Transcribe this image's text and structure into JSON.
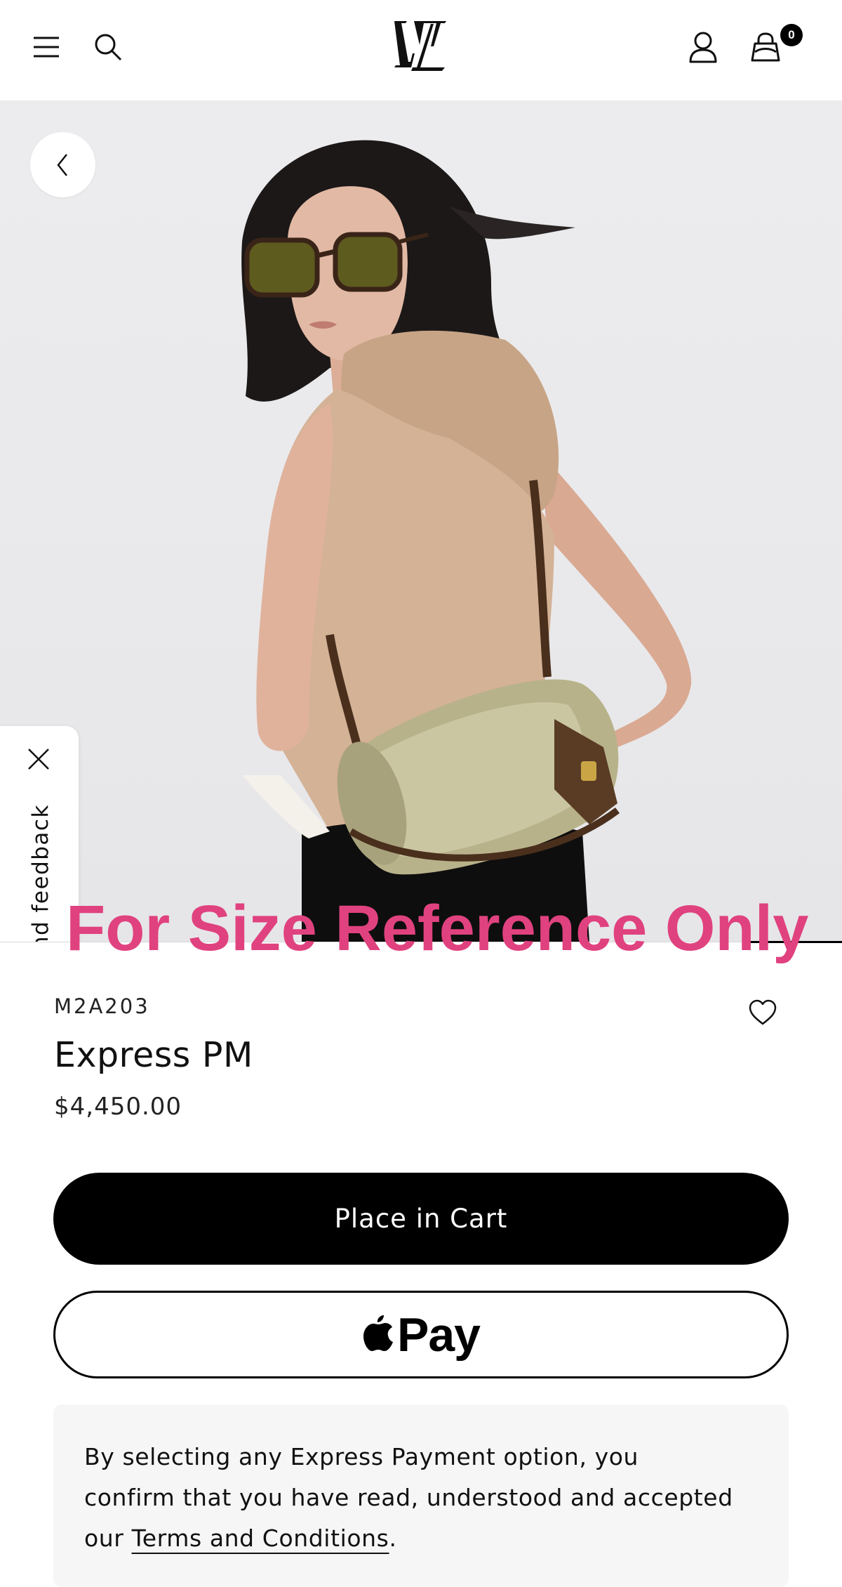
{
  "header": {
    "menu_icon": "menu-icon",
    "search_icon": "search-icon",
    "logo_icon": "lv-logo",
    "account_icon": "account-icon",
    "bag_icon": "shopping-bag-icon",
    "bag_count": "0"
  },
  "hero": {
    "back_icon": "chevron-left-icon",
    "feedback_label": "Send feedback",
    "feedback_close_icon": "close-icon",
    "watermark": "For Size Reference Only",
    "watermark_color": "#e0427f",
    "image_progress": 0.11
  },
  "product": {
    "sku": "M2A203",
    "name": "Express PM",
    "price": "$4,450.00",
    "wishlist_icon": "heart-icon"
  },
  "actions": {
    "cart_label": "Place in Cart",
    "apple_pay_label": "Pay",
    "apple_icon": "apple-icon"
  },
  "notice": {
    "text": "By selecting any Express Payment option, you confirm that you have read, understood and accepted our ",
    "link_text": "Terms and Conditions",
    "suffix": "."
  }
}
